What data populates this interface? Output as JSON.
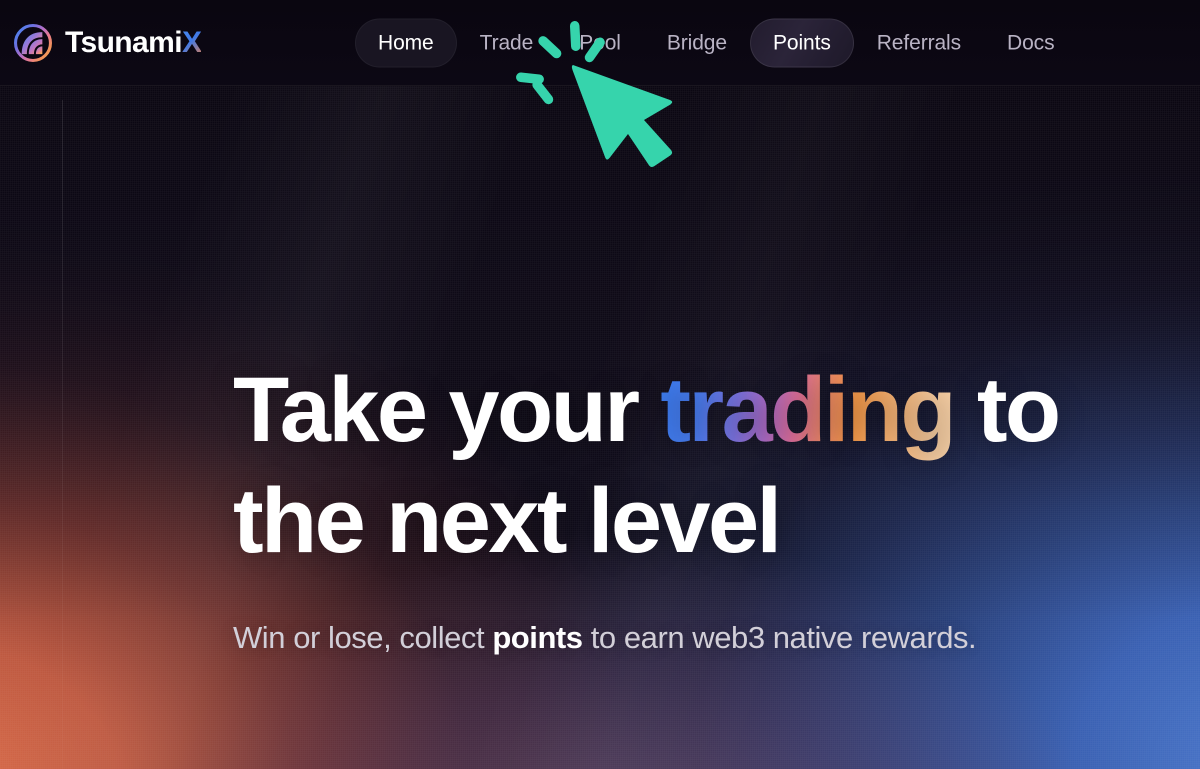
{
  "brand": {
    "name_main": "Tsunami",
    "name_accent": "X",
    "logo_icon": "tsunami-wave-logo-icon"
  },
  "nav": {
    "items": [
      {
        "label": "Home",
        "state": "active"
      },
      {
        "label": "Trade",
        "state": "default"
      },
      {
        "label": "Pool",
        "state": "default"
      },
      {
        "label": "Bridge",
        "state": "default"
      },
      {
        "label": "Points",
        "state": "hover"
      },
      {
        "label": "Referrals",
        "state": "default"
      },
      {
        "label": "Docs",
        "state": "default"
      }
    ]
  },
  "hero": {
    "title_line1_a": "Take your ",
    "title_line1_gradient": "trading",
    "title_line1_b": " to",
    "title_line2": "the next level",
    "sub_a": "Win or lose, collect ",
    "sub_emphasis": "points",
    "sub_b": " to earn web3 native rewards."
  },
  "cursor": {
    "icon": "click-cursor-icon",
    "color": "#36d4ac"
  },
  "colors": {
    "header_bg": "#0b0712",
    "accent_teal": "#36d4ac",
    "gradient_blue": "#3d7ff5",
    "gradient_pink": "#e0709e",
    "gradient_orange": "#f59a4a",
    "gradient_peach": "#fbcfa2",
    "bg_warm": "#d9664b",
    "bg_cool": "#3e68c0",
    "text_primary": "#ffffff",
    "text_muted": "#b9b3c4"
  }
}
